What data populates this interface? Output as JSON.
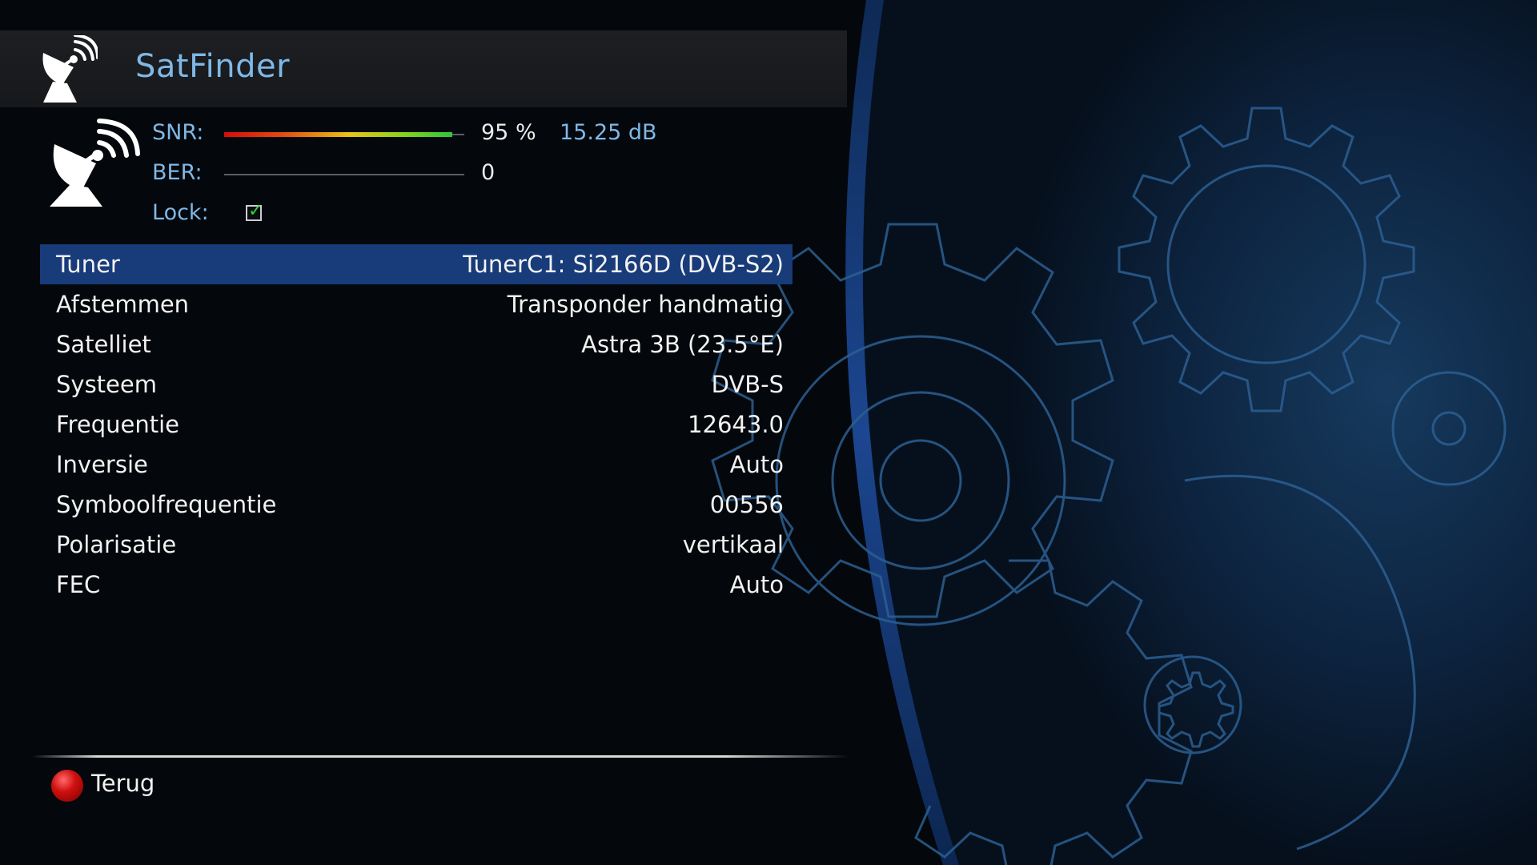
{
  "header": {
    "title": "SatFinder",
    "icon": "satellite-dish-icon"
  },
  "signal": {
    "icon": "satellite-dish-icon",
    "snr_label": "SNR:",
    "snr_percent_text": "95 %",
    "snr_db_text": "15.25 dB",
    "snr_level": 0.95,
    "ber_label": "BER:",
    "ber_value": "0",
    "ber_level": 0,
    "lock_label": "Lock:",
    "locked": true
  },
  "settings": [
    {
      "label": "Tuner",
      "value": "TunerC1: Si2166D (DVB-S2)",
      "selected": true
    },
    {
      "label": "Afstemmen",
      "value": "Transponder handmatig",
      "selected": false
    },
    {
      "label": "Satelliet",
      "value": "Astra 3B (23.5°E)",
      "selected": false
    },
    {
      "label": "Systeem",
      "value": "DVB-S",
      "selected": false
    },
    {
      "label": "Frequentie",
      "value": "12643.0",
      "selected": false
    },
    {
      "label": "Inversie",
      "value": "Auto",
      "selected": false
    },
    {
      "label": "Symboolfrequentie",
      "value": "00556",
      "selected": false
    },
    {
      "label": "Polarisatie",
      "value": "vertikaal",
      "selected": false
    },
    {
      "label": "FEC",
      "value": "Auto",
      "selected": false
    }
  ],
  "footer": {
    "back_label": "Terug",
    "back_button_color": "#d01010"
  },
  "colors": {
    "accent_text": "#7fb8e6",
    "selection": "#183b79",
    "lock_check": "#2fd33a"
  }
}
